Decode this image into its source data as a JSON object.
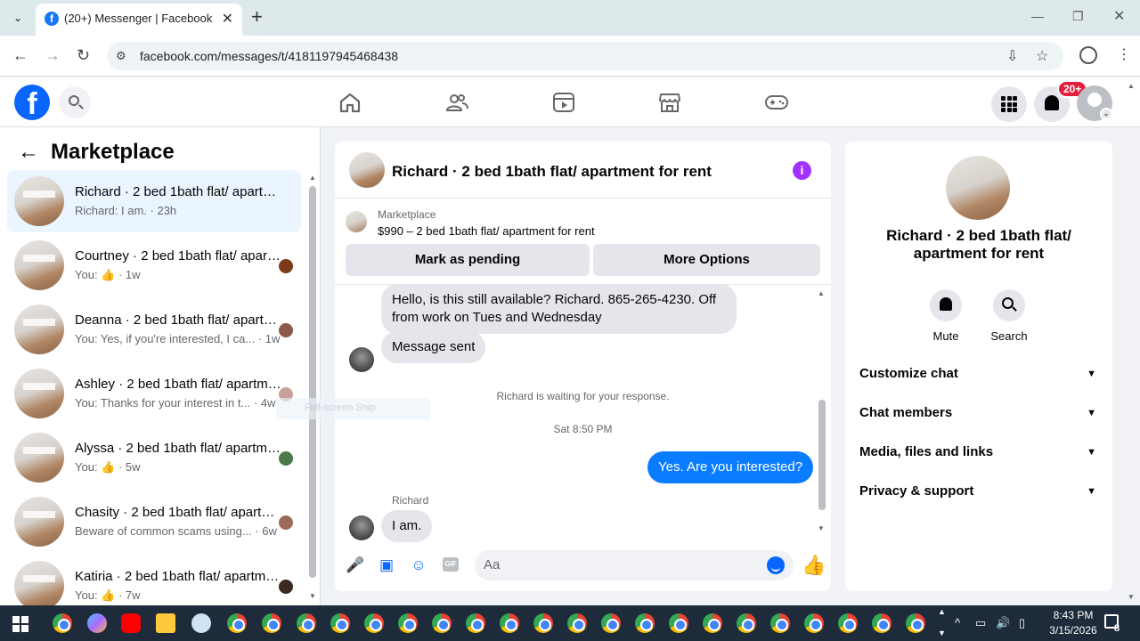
{
  "browser": {
    "tab_title": "(20+) Messenger | Facebook",
    "url": "facebook.com/messages/t/4181197945468438",
    "favicon": "f"
  },
  "fb_header": {
    "logo": "f",
    "notification_badge": "20+"
  },
  "left_panel": {
    "title": "Marketplace",
    "conversations": [
      {
        "name": "Richard · 2 bed 1bath flat/ apartment for rent",
        "snippet": "Richard: I am. · 23h",
        "active": true
      },
      {
        "name": "Courtney · 2 bed 1bath flat/ apartment for rent",
        "snippet": "You: 👍 · 1w"
      },
      {
        "name": "Deanna · 2 bed 1bath flat/ apartment for rent",
        "snippet": "You: Yes, if you're interested, I ca... · 1w"
      },
      {
        "name": "Ashley · 2 bed 1bath flat/ apartment for rent",
        "snippet": "You: Thanks for your interest in t... · 4w"
      },
      {
        "name": "Alyssa · 2 bed 1bath flat/ apartment for rent",
        "snippet": "You: 👍 · 5w"
      },
      {
        "name": "Chasity · 2 bed 1bath flat/ apartment for rent",
        "snippet": "Beware of common scams using... · 6w"
      },
      {
        "name": "Katiria · 2 bed 1bath flat/ apartment for rent",
        "snippet": "You: 👍 · 7w"
      }
    ]
  },
  "chat": {
    "title": "Richard · 2 bed 1bath flat/ apartment for rent",
    "marketplace_label": "Marketplace",
    "listing": "$990 – 2 bed 1bath flat/ apartment for rent",
    "mark_pending": "Mark as pending",
    "more_options": "More Options",
    "messages": {
      "m1": "Hello, is this still available?  Richard. 865-265-4230. Off from work on Tues and Wednesday",
      "m2": "Message sent",
      "waiting": "Richard is waiting for your response.",
      "timestamp": "Sat 8:50 PM",
      "m3": "Yes. Are you interested?",
      "sender": "Richard",
      "m4": "I am."
    },
    "compose_placeholder": "Aa",
    "gif_label": "GIF"
  },
  "right_panel": {
    "title": "Richard · 2 bed 1bath flat/ apartment for rent",
    "mute": "Mute",
    "search": "Search",
    "sections": [
      "Customize chat",
      "Chat members",
      "Media, files and links",
      "Privacy & support"
    ]
  },
  "overlay": {
    "snip_text": "Full-screen Snip"
  },
  "taskbar": {
    "time": "8:43 PM",
    "date": "3/15/2026",
    "notification_count": "8"
  }
}
